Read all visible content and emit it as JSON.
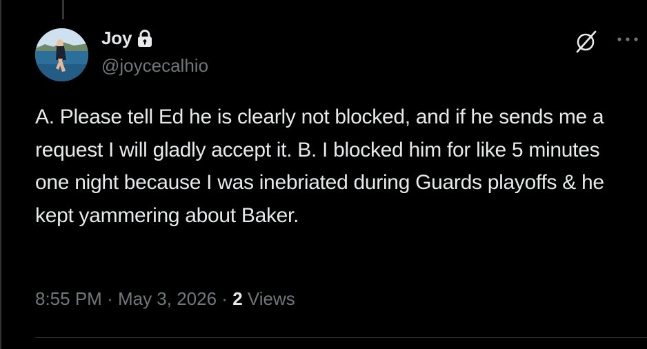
{
  "tweet": {
    "author": {
      "display_name": "Joy",
      "handle": "@joycecalhio",
      "protected_icon": "lock-icon",
      "avatar_icon": "avatar"
    },
    "text": "A. Please tell Ed he is clearly not blocked, and if he sends me a request I will gladly accept it. B. I blocked him for like 5 minutes one night because I was inebriated during Guards playoffs & he kept yammering about Baker.",
    "time": "8:55 PM",
    "separator": "·",
    "date": "May 3, 2026",
    "views_count": "2",
    "views_label": "Views",
    "actions": {
      "grok_icon": "grok-icon",
      "more_icon": "more-icon"
    }
  },
  "colors": {
    "background": "#000000",
    "primary_text": "#e7e9ea",
    "secondary_text": "#71767b",
    "divider": "#2f3336"
  }
}
